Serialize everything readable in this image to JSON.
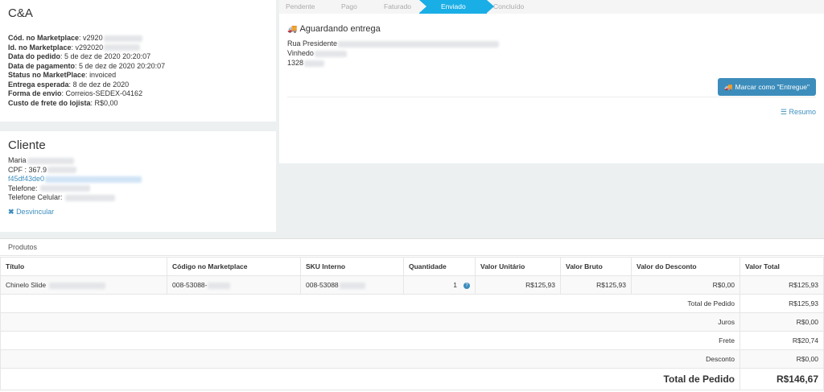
{
  "store": {
    "title": "C&A",
    "fields": [
      {
        "label": "Cód. no Marketplace",
        "value": "v2920"
      },
      {
        "label": "Id. no Marketplace",
        "value": "v292020"
      },
      {
        "label": "Data do pedido",
        "value": "5 de dez de 2020 20:20:07"
      },
      {
        "label": "Data de pagamento",
        "value": "5 de dez de 2020 20:20:07"
      },
      {
        "label": "Status no MarketPlace",
        "value": "invoiced"
      },
      {
        "label": "Entrega esperada",
        "value": "8 de dez de 2020"
      },
      {
        "label": "Forma de envio",
        "value": "Correios-SEDEX-04162"
      },
      {
        "label": "Custo de frete do lojista",
        "value": "R$0,00"
      }
    ]
  },
  "client": {
    "title": "Cliente",
    "name": "Maria",
    "cpf": "CPF : 367.9",
    "email": "f45df43de0",
    "phone_label": "Telefone:",
    "cell_label": "Telefone Celular:",
    "unlink_label": "Desvincular"
  },
  "status": {
    "steps": [
      "Pendente",
      "Pago",
      "Faturado",
      "Enviado",
      "Concluído"
    ],
    "active_step": "Enviado",
    "ship_title": "Aguardando entrega",
    "address": [
      "Rua Presidente",
      "Vinhedo",
      "1328"
    ],
    "mark_button": "Marcar como \"Entregue\"",
    "resumo": "Resumo"
  },
  "products": {
    "title": "Produtos",
    "columns": [
      "Título",
      "Código no Marketplace",
      "SKU Interno",
      "Quantidade",
      "Valor Unitário",
      "Valor Bruto",
      "Valor do Desconto",
      "Valor Total"
    ],
    "rows": [
      {
        "title": "Chinelo Slide",
        "code": "008-53088-",
        "sku": "008-53088",
        "qty": "1",
        "unit": "R$125,93",
        "gross": "R$125,93",
        "discount": "R$0,00",
        "total": "R$125,93"
      }
    ],
    "summary": [
      {
        "label": "Total de Pedido",
        "value": "R$125,93"
      },
      {
        "label": "Juros",
        "value": "R$0,00"
      },
      {
        "label": "Frete",
        "value": "R$20,74"
      },
      {
        "label": "Desconto",
        "value": "R$0,00"
      }
    ],
    "grand_total": {
      "label": "Total de Pedido",
      "value": "R$146,67"
    }
  },
  "colors": {
    "accent": "#1aaee6",
    "button": "#3c8dbc",
    "background": "#ecf0f1"
  }
}
